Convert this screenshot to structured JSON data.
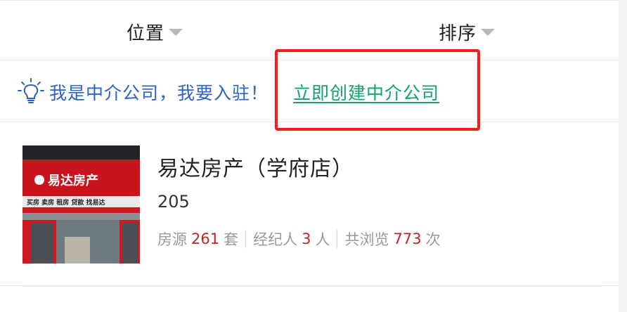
{
  "filters": {
    "location_label": "位置",
    "sort_label": "排序"
  },
  "notice": {
    "text": "我是中介公司，我要入驻！",
    "link": "立即创建中介公司",
    "link_color": "#12a36b",
    "text_color": "#2b63c4",
    "highlight_color": "#ff1a1a"
  },
  "agency": {
    "name": "易达房产（学府店）",
    "code": "205",
    "listings_label": "房源",
    "listings_count": "261",
    "listings_unit": "套",
    "agents_label": "经纪人",
    "agents_count": "3",
    "agents_unit": "人",
    "views_label": "共浏览",
    "views_count": "773",
    "views_unit": "次",
    "thumbnail": {
      "sign_text": "易达房产",
      "services_text": "买房 卖房 租房 贷款 找易达"
    }
  },
  "icons": {
    "caret": "caret-down-icon",
    "bulb": "lightbulb-icon"
  }
}
